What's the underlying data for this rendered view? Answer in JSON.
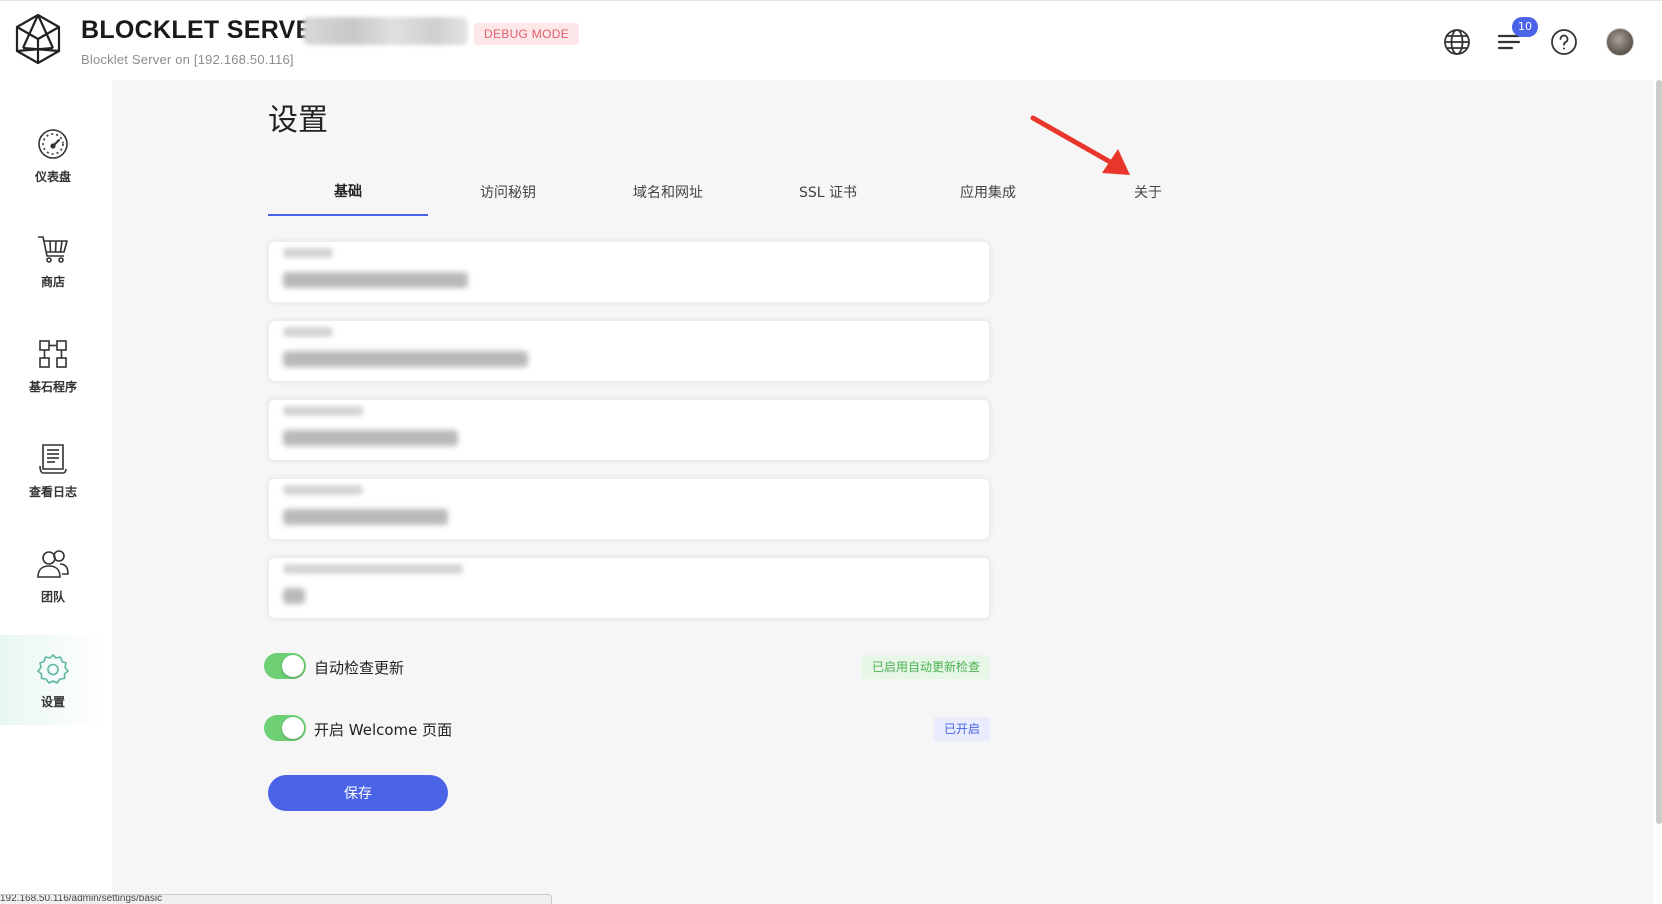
{
  "header": {
    "title": "BLOCKLET SERVER",
    "debug_badge": "DEBUG MODE",
    "subtitle": "Blocklet Server on [192.168.50.116]",
    "notification_count": "10",
    "icons": [
      "globe-icon",
      "notifications-icon",
      "help-icon",
      "user-avatar"
    ]
  },
  "sidebar": {
    "items": [
      {
        "label": "仪表盘",
        "icon": "dashboard-gauge-icon",
        "active": false
      },
      {
        "label": "商店",
        "icon": "shopping-cart-icon",
        "active": false
      },
      {
        "label": "基石程序",
        "icon": "blocklets-grid-icon",
        "active": false
      },
      {
        "label": "查看日志",
        "icon": "log-document-icon",
        "active": false
      },
      {
        "label": "团队",
        "icon": "team-icon",
        "active": false
      },
      {
        "label": "设置",
        "icon": "settings-gear-icon",
        "active": true
      }
    ]
  },
  "main": {
    "page_title": "设置",
    "tabs": [
      {
        "label": "基础",
        "active": true
      },
      {
        "label": "访问秘钥",
        "active": false
      },
      {
        "label": "域名和网址",
        "active": false
      },
      {
        "label": "SSL 证书",
        "active": false
      },
      {
        "label": "应用集成",
        "active": false
      },
      {
        "label": "关于",
        "active": false
      }
    ],
    "toggles": [
      {
        "label": "自动检查更新",
        "on": true,
        "status": "已启用自动更新检查"
      },
      {
        "label": "开启 Welcome 页面",
        "on": true,
        "status": "已开启"
      }
    ],
    "save_label": "保存"
  },
  "statusbar": {
    "url": "192.168.50.116/admin/settings/basic"
  },
  "colors": {
    "accent": "#4a63e7",
    "toggle_on": "#6fcf75",
    "debug": "#e0606d",
    "arrow": "#e8362a"
  }
}
